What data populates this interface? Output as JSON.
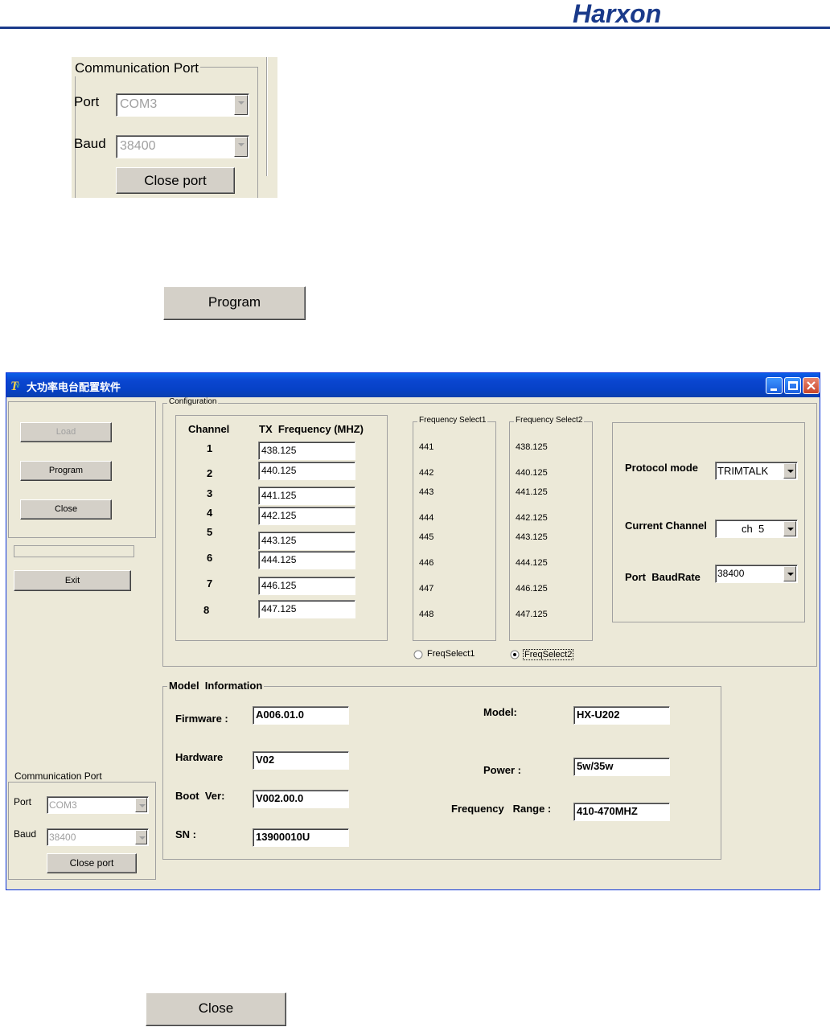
{
  "brand": {
    "logo_text": "Harxon",
    "accent": "#1a3a8a",
    "logo_h_color": "#f5a623"
  },
  "snippet_comm": {
    "title": "Communication Port",
    "port_label": "Port",
    "port_value": "COM3",
    "baud_label": "Baud",
    "baud_value": "38400",
    "close_port_label": "Close port"
  },
  "program_button_label": "Program",
  "window": {
    "title": "大功率电台配置软件",
    "left_panel": {
      "load_label": "Load",
      "program_label": "Program",
      "close_label": "Close",
      "exit_label": "Exit"
    },
    "comm_port": {
      "title": "Communication Port",
      "port_label": "Port",
      "port_value": "COM3",
      "baud_label": "Baud",
      "baud_value": "38400",
      "close_port_label": "Close port"
    },
    "configuration": {
      "title": "Configuration",
      "channel_header": "Channel",
      "freq_header": "TX  Frequency (MHZ)",
      "channels": [
        {
          "num": "1",
          "freq": "438.125"
        },
        {
          "num": "2",
          "freq": "440.125"
        },
        {
          "num": "3",
          "freq": "441.125"
        },
        {
          "num": "4",
          "freq": "442.125"
        },
        {
          "num": "5",
          "freq": "443.125"
        },
        {
          "num": "6",
          "freq": "444.125"
        },
        {
          "num": "7",
          "freq": "446.125"
        },
        {
          "num": "8",
          "freq": "447.125"
        }
      ],
      "freq_select1": {
        "title": "Frequency Select1",
        "values": [
          "441",
          "442",
          "443",
          "444",
          "445",
          "446",
          "447",
          "448"
        ]
      },
      "freq_select2": {
        "title": "Frequency Select2",
        "values": [
          "438.125",
          "440.125",
          "441.125",
          "442.125",
          "443.125",
          "444.125",
          "446.125",
          "447.125"
        ]
      },
      "radio1_label": "FreqSelect1",
      "radio2_label": "FreqSelect2",
      "protocol_label": "Protocol mode",
      "protocol_value": "TRIMTALK",
      "channel_label": "Current Channel",
      "channel_value": "ch  5",
      "baud_label": "Port  BaudRate",
      "baud_value": "38400"
    },
    "model_info": {
      "title": "Model  Information",
      "firmware_label": "Firmware :",
      "firmware_value": "A006.01.0",
      "hardware_label": "Hardware",
      "hardware_value": "V02",
      "boot_label": "Boot  Ver:",
      "boot_value": "V002.00.0",
      "sn_label": "SN :",
      "sn_value": "13900010U",
      "model_label": "Model:",
      "model_value": "HX-U202",
      "power_label": "Power :",
      "power_value": "5w/35w",
      "range_label": "Frequency   Range :",
      "range_value": "410-470MHZ"
    }
  },
  "close_button_label": "Close"
}
